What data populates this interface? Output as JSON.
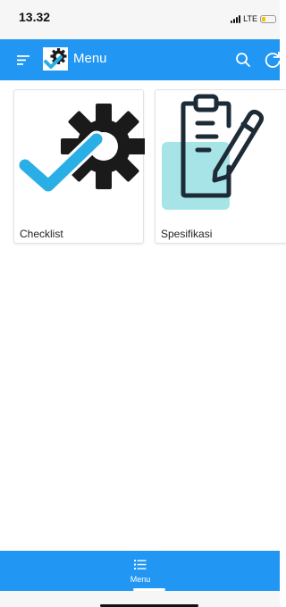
{
  "status_bar": {
    "time": "13.32",
    "network": "LTE",
    "battery_level": 0.25
  },
  "toolbar": {
    "title": "Menu",
    "menu_icon": "hamburger-icon",
    "search_icon": "search-icon",
    "refresh_icon": "refresh-icon"
  },
  "cards": [
    {
      "label": "Checklist",
      "icon": "checklist-gear-icon"
    },
    {
      "label": "Spesifikasi",
      "icon": "clipboard-pencil-icon"
    }
  ],
  "bottom_nav": {
    "items": [
      {
        "label": "Menu",
        "icon": "list-icon",
        "active": true
      }
    ]
  },
  "colors": {
    "primary": "#2196f3",
    "check": "#2aaee6",
    "gear": "#1a1a1a",
    "clipboard_accent": "#a7e4e8",
    "clipboard_stroke": "#1d2b36"
  }
}
